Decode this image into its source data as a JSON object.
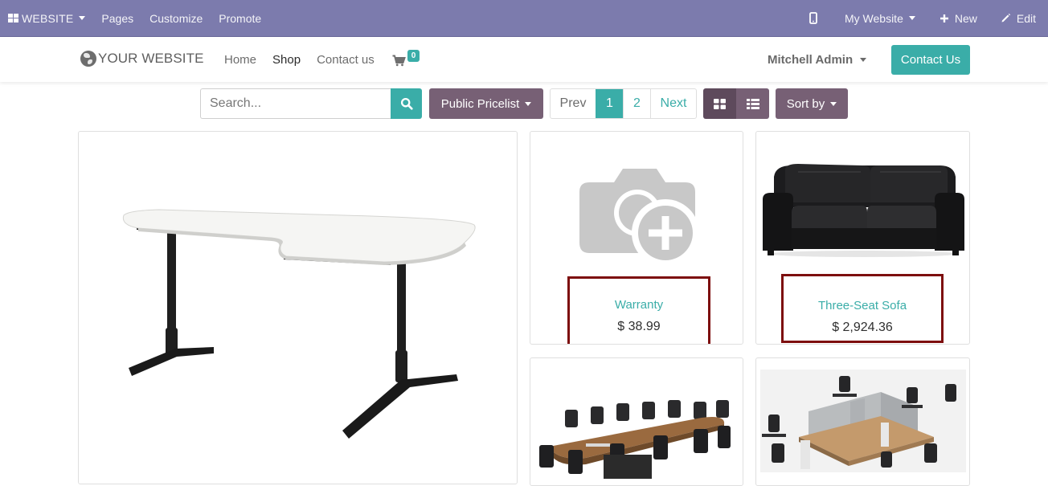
{
  "admin_bar": {
    "brand": "WEBSITE",
    "menu": [
      "Pages",
      "Customize",
      "Promote"
    ],
    "website_selector": "My Website",
    "new_label": "New",
    "edit_label": "Edit"
  },
  "header": {
    "logo_text": "YOUR WEBSITE",
    "nav": [
      "Home",
      "Shop",
      "Contact us"
    ],
    "active_nav": "Shop",
    "cart_count": "0",
    "user_name": "Mitchell Admin",
    "contact_button": "Contact Us"
  },
  "toolbar": {
    "search_placeholder": "Search...",
    "pricelist": "Public Pricelist",
    "pager": {
      "prev": "Prev",
      "pages": [
        "1",
        "2"
      ],
      "current": "1",
      "next": "Next"
    },
    "sort_label": "Sort by"
  },
  "products": [
    {
      "name": "",
      "price": "",
      "image": "corner-desk"
    },
    {
      "name": "Warranty",
      "price": "$ 38.99",
      "image": "placeholder-camera"
    },
    {
      "name": "Three-Seat Sofa",
      "price": "$ 2,924.36",
      "image": "black-leather-sofa"
    },
    {
      "name": "",
      "price": "",
      "image": "conference-table"
    },
    {
      "name": "",
      "price": "",
      "image": "office-workstations"
    }
  ],
  "colors": {
    "admin_bar": "#7c7bad",
    "accent": "#3aada8",
    "secondary": "#776075",
    "highlight_border": "#7d0e0e"
  }
}
